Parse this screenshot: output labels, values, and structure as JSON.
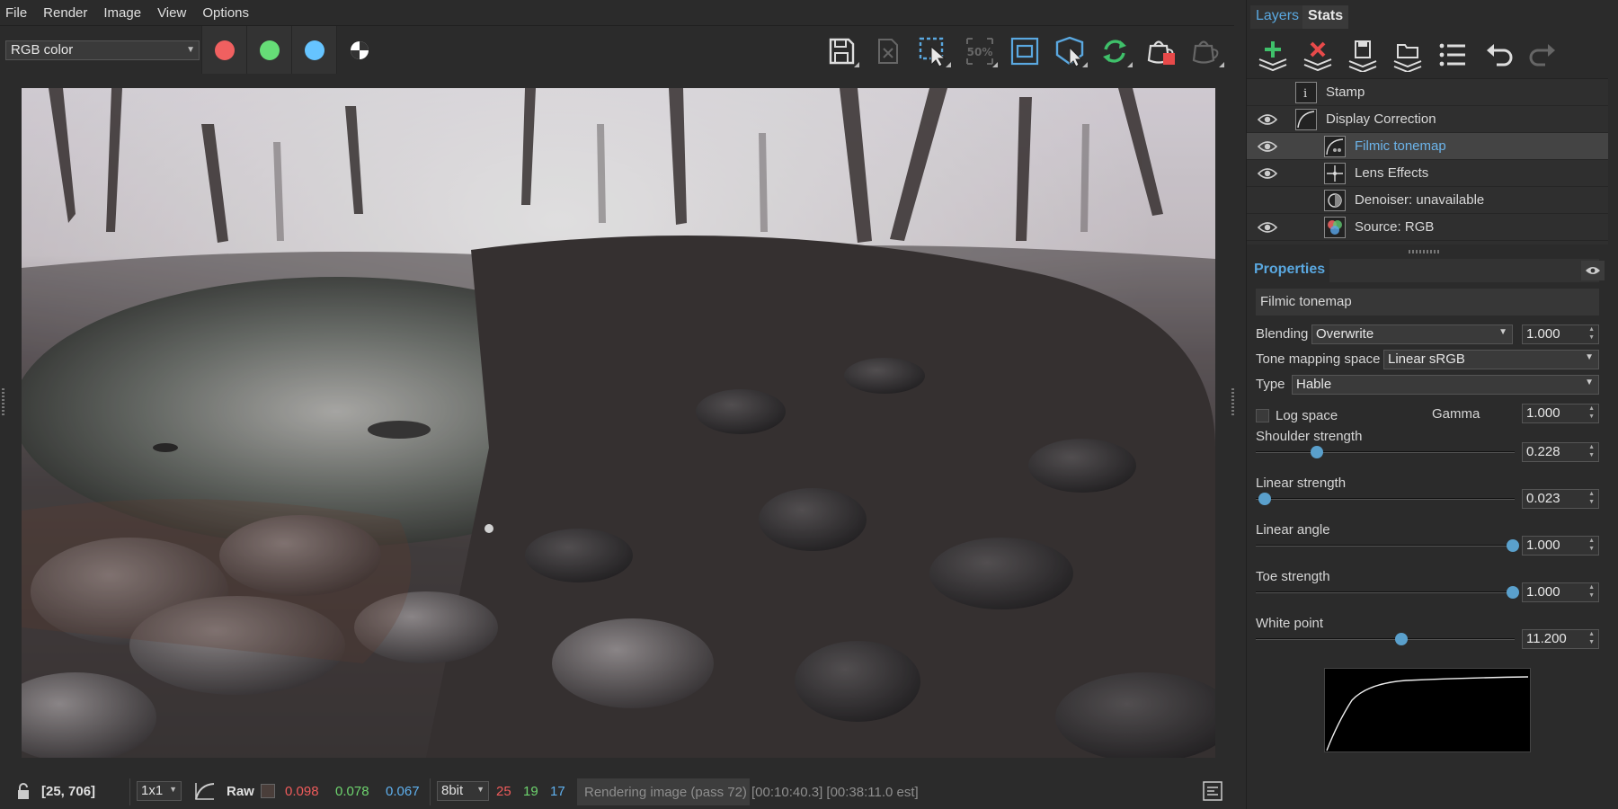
{
  "menu": [
    "File",
    "Render",
    "Image",
    "View",
    "Options"
  ],
  "toolbar": {
    "channel_select": "RGB color",
    "channel_swatches": [
      {
        "name": "red-channel",
        "color": "#f06060"
      },
      {
        "name": "green-channel",
        "color": "#66dd77"
      },
      {
        "name": "blue-channel",
        "color": "#66c4ff"
      }
    ],
    "zoom_label": "50%",
    "icons": [
      "save-icon",
      "close-image-icon",
      "select-region-icon",
      "zoom-50-icon",
      "fit-view-icon",
      "focus-picker-icon",
      "restart-render-icon",
      "stop-render-icon",
      "pause-render-icon"
    ]
  },
  "status": {
    "coords": "[25, 706]",
    "zoom": "1x1",
    "raw_label": "Raw",
    "pixel_r": "0.098",
    "pixel_g": "0.078",
    "pixel_b": "0.067",
    "bit_depth": "8bit",
    "int_r": "25",
    "int_g": "19",
    "int_b": "17",
    "render_status": "Rendering image (pass 72)",
    "render_time": "[00:10:40.3] [00:38:11.0 est]",
    "colors": {
      "r": "#ef5b5b",
      "g": "#6ed46e",
      "b": "#5fb0ee"
    }
  },
  "tabs": {
    "layers": "Layers",
    "stats": "Stats"
  },
  "layer_toolbar_icons": [
    "add-layer-icon",
    "remove-layer-icon",
    "save-layers-icon",
    "load-layers-icon",
    "layer-list-icon",
    "undo-icon",
    "redo-icon"
  ],
  "layers": [
    {
      "name": "Stamp",
      "visible": false,
      "icon": "info-icon"
    },
    {
      "name": "Display Correction",
      "visible": true,
      "icon": "curve-icon"
    },
    {
      "name": "Filmic tonemap",
      "visible": true,
      "icon": "tonemap-icon",
      "selected": true
    },
    {
      "name": "Lens Effects",
      "visible": true,
      "icon": "lens-star-icon"
    },
    {
      "name": "Denoiser: unavailable",
      "visible": false,
      "icon": "denoiser-icon"
    },
    {
      "name": "Source: RGB",
      "visible": true,
      "icon": "rgb-source-icon"
    }
  ],
  "properties": {
    "title": "Properties",
    "layer_name": "Filmic tonemap",
    "blending_label": "Blending",
    "blending_value": "Overwrite",
    "blending_amount": "1.000",
    "tone_space_label": "Tone mapping space",
    "tone_space_value": "Linear sRGB",
    "type_label": "Type",
    "type_value": "Hable",
    "log_space_label": "Log space",
    "gamma_label": "Gamma",
    "gamma_value": "1.000",
    "sliders": [
      {
        "label": "Shoulder strength",
        "value": "0.228",
        "fraction": 0.228
      },
      {
        "label": "Linear strength",
        "value": "0.023",
        "fraction": 0.023
      },
      {
        "label": "Linear angle",
        "value": "1.000",
        "fraction": 1.0
      },
      {
        "label": "Toe strength",
        "value": "1.000",
        "fraction": 1.0
      },
      {
        "label": "White point",
        "value": "11.200",
        "fraction": 0.56
      }
    ]
  }
}
